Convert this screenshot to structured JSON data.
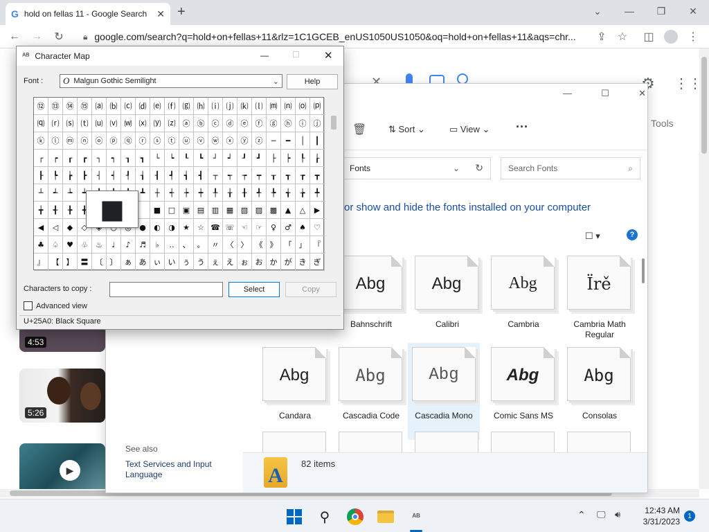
{
  "browser": {
    "tab_title": "hold on fellas 11 - Google Search",
    "url": "google.com/search?q=hold+on+fellas+11&rlz=1C1GCEB_enUS1050US1050&oq=hold+on+fellas+11&aqs=chr..."
  },
  "google": {
    "tools_label": "Tools",
    "videos": [
      {
        "duration": "4:53"
      },
      {
        "duration": "5:26"
      },
      {
        "duration": ""
      }
    ]
  },
  "fonts_window": {
    "toolbar": {
      "sort_label": "Sort",
      "view_label": "View",
      "more_label": "···"
    },
    "breadcrumb": "Fonts",
    "search_placeholder": "Search Fonts",
    "heading": "or show and hide the fonts installed on your computer",
    "fonts": [
      {
        "sample": "Abg",
        "name": "Bahnschrift"
      },
      {
        "sample": "Abg",
        "name": "Calibri"
      },
      {
        "sample": "Abg",
        "name": "Cambria"
      },
      {
        "sample": "Ïrě",
        "name": "Cambria Math Regular"
      },
      {
        "sample": "Abg",
        "name": "Candara"
      },
      {
        "sample": "Abg",
        "name": "Cascadia Code"
      },
      {
        "sample": "Abg",
        "name": "Cascadia Mono"
      },
      {
        "sample": "Abg",
        "name": "Comic Sans MS"
      },
      {
        "sample": "Abg",
        "name": "Consolas"
      }
    ],
    "see_also_label": "See also",
    "see_also_link": "Text Services and Input Language",
    "status_items": "82 items"
  },
  "charmap": {
    "title": "Character Map",
    "font_label": "Font :",
    "font_value": "Malgun Gothic Semilight",
    "font_glyph": "O",
    "help_label": "Help",
    "copy_label": "Characters to copy :",
    "copy_value": "",
    "select_label": "Select",
    "copy_button": "Copy",
    "advanced_label": "Advanced view",
    "status": "U+25A0: Black Square",
    "magnified": "■",
    "rows": [
      [
        "⑫",
        "⑬",
        "⑭",
        "⑮",
        "⒜",
        "⒝",
        "⒞",
        "⒟",
        "⒠",
        "⒡",
        "⒢",
        "⒣",
        "⒤",
        "⒥",
        "⒦",
        "⒧",
        "⒨",
        "⒩",
        "⒪",
        "⒫"
      ],
      [
        "⒬",
        "⒭",
        "⒮",
        "⒯",
        "⒰",
        "⒱",
        "⒲",
        "⒳",
        "⒴",
        "⒵",
        "ⓐ",
        "ⓑ",
        "ⓒ",
        "ⓓ",
        "ⓔ",
        "ⓕ",
        "ⓖ",
        "ⓗ",
        "ⓘ",
        "ⓙ"
      ],
      [
        "ⓚ",
        "ⓛ",
        "ⓜ",
        "ⓝ",
        "ⓞ",
        "ⓟ",
        "ⓠ",
        "ⓡ",
        "ⓢ",
        "ⓣ",
        "ⓤ",
        "ⓥ",
        "ⓦ",
        "ⓧ",
        "ⓨ",
        "ⓩ",
        "─",
        "━",
        "│",
        "┃"
      ],
      [
        "┌",
        "┍",
        "┎",
        "┏",
        "┐",
        "┑",
        "┒",
        "┓",
        "└",
        "┕",
        "┖",
        "┗",
        "┘",
        "┙",
        "┚",
        "┛",
        "├",
        "┝",
        "┞",
        "┟"
      ],
      [
        "┠",
        "┡",
        "┢",
        "┣",
        "┤",
        "┥",
        "┦",
        "┧",
        "┨",
        "┩",
        "┪",
        "┫",
        "┬",
        "┭",
        "┮",
        "┯",
        "┰",
        "┱",
        "┲",
        "┳"
      ],
      [
        "┴",
        "┵",
        "┶",
        "┷",
        "┸",
        "┹",
        "┺",
        "┻",
        "┼",
        "┽",
        "┾",
        "┿",
        "╀",
        "╁",
        "╂",
        "╃",
        "╄",
        "╅",
        "╆",
        "╇"
      ],
      [
        "╈",
        "╉",
        "╊",
        "╋",
        "",
        "",
        "",
        "",
        "■",
        "□",
        "▣",
        "▤",
        "▥",
        "▦",
        "▧",
        "▨",
        "▩",
        "▲",
        "△",
        "▶"
      ],
      [
        "◀",
        "◁",
        "◆",
        "◇",
        "◈",
        "○",
        "◎",
        "●",
        "◐",
        "◑",
        "★",
        "☆",
        "☎",
        "☏",
        "☜",
        "☞",
        "♀",
        "♂",
        "♠",
        "♡"
      ],
      [
        "♣",
        "♤",
        "♥",
        "♧",
        "♨",
        "♩",
        "♪",
        "♬",
        "♭",
        "‥",
        "、",
        "。",
        "〃",
        "〈",
        "〉",
        "《",
        "》",
        "「",
        "」",
        "『"
      ],
      [
        "』",
        "【",
        "】",
        "〓",
        "〔",
        "〕",
        "ぁ",
        "あ",
        "ぃ",
        "い",
        "ぅ",
        "う",
        "ぇ",
        "え",
        "ぉ",
        "お",
        "か",
        "が",
        "き",
        "ぎ"
      ]
    ]
  },
  "taskbar": {
    "time": "12:43 AM",
    "date": "3/31/2023",
    "notification_count": "1"
  },
  "colors": {
    "accent": "#0067c0",
    "link_blue": "#1a4fa0",
    "google_blue": "#4285f4",
    "help_blue": "#1b75d0"
  }
}
